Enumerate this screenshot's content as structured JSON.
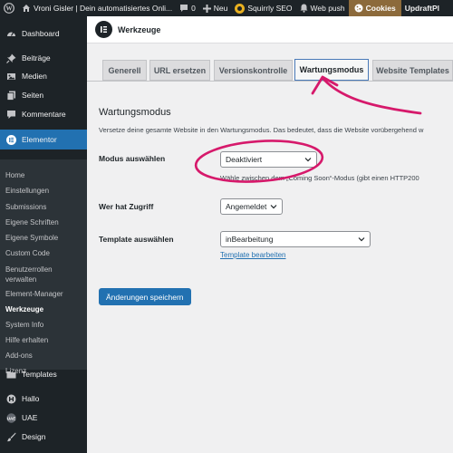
{
  "adminbar": {
    "site_name": "Vroni Gisler | Dein automatisiertes Onli...",
    "comments_count": "0",
    "new_label": "Neu",
    "seo_label": "Squirrly SEO",
    "push_label": "Web push",
    "cookies_label": "Cookies",
    "updraft_label": "UpdraftPl"
  },
  "sidebar": {
    "items": [
      {
        "label": "Dashboard",
        "icon": "dashboard-icon"
      },
      {
        "label": "Beiträge",
        "icon": "pin-icon"
      },
      {
        "label": "Medien",
        "icon": "media-icon"
      },
      {
        "label": "Seiten",
        "icon": "pages-icon"
      },
      {
        "label": "Kommentare",
        "icon": "comments-icon"
      },
      {
        "label": "Elementor",
        "icon": "elementor-icon"
      },
      {
        "label": "Templates",
        "icon": "folder-icon"
      },
      {
        "label": "Hallo",
        "icon": "hello-icon"
      },
      {
        "label": "UAE",
        "icon": "uae-icon"
      },
      {
        "label": "Design",
        "icon": "brush-icon"
      }
    ],
    "submenu": [
      "Home",
      "Einstellungen",
      "Submissions",
      "Eigene Schriften",
      "Eigene Symbole",
      "Custom Code",
      "Benutzerrollen verwalten",
      "Element-Manager",
      "Werkzeuge",
      "System Info",
      "Hilfe erhalten",
      "Add-ons",
      "Lizenz"
    ],
    "current_submenu": "Werkzeuge"
  },
  "header": {
    "title": "Werkzeuge"
  },
  "tabs": [
    {
      "label": "Generell"
    },
    {
      "label": "URL ersetzen"
    },
    {
      "label": "Versionskontrolle"
    },
    {
      "label": "Wartungsmodus"
    },
    {
      "label": "Website Templates"
    }
  ],
  "active_tab": "Wartungsmodus",
  "main": {
    "section_title": "Wartungsmodus",
    "section_desc": "Versetze deine gesamte Website in den Wartungsmodus. Das bedeutet, dass die Website vorübergehend w",
    "mode_label": "Modus auswählen",
    "mode_value": "Deaktiviert",
    "mode_hint": "Wähle zwischen dem „Coming Soon“-Modus (gibt einen HTTP200",
    "access_label": "Wer hat Zugriff",
    "access_value": "Angemeldet",
    "template_label": "Template auswählen",
    "template_value": "inBearbeitung",
    "template_edit_link": "Template bearbeiten",
    "save_button": "Änderungen speichern"
  },
  "colors": {
    "accent": "#2271b1",
    "annotation": "#d6196b",
    "adminbar_bg": "#1d2327"
  }
}
